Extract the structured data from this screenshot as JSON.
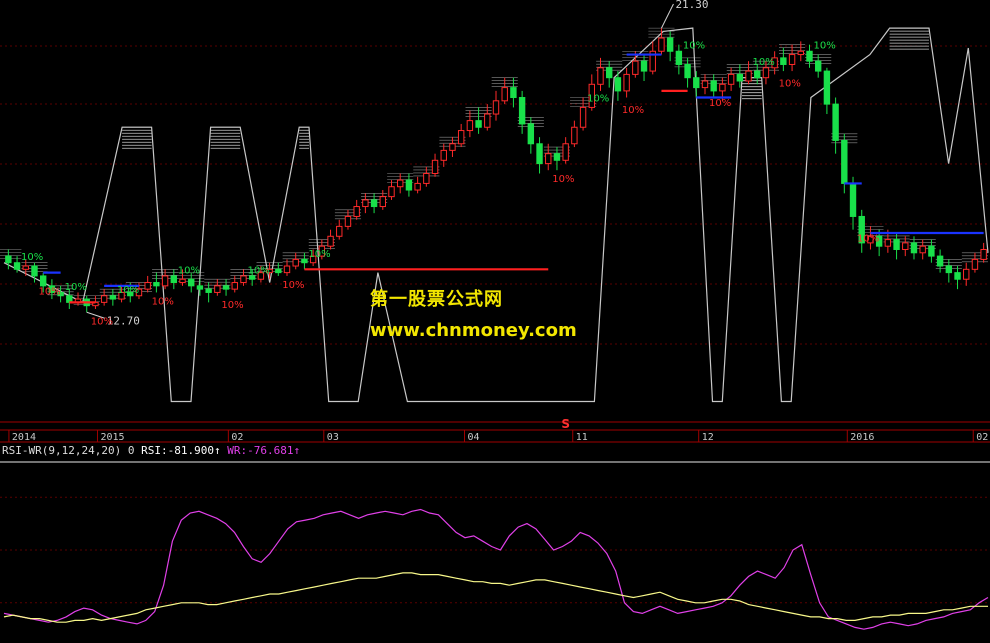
{
  "chart_data": {
    "type": "candlestick",
    "price_axis": {
      "min": 9.5,
      "max": 22.0
    },
    "price_high_label": "21.30",
    "price_low_label": "12.70",
    "signal_label": "10%",
    "pct_label_style": "±10%",
    "s_marker": "S",
    "time_axis_labels": [
      "2014",
      "2015",
      "02",
      "03",
      "04",
      "11",
      "12",
      "2016",
      "02"
    ],
    "candles": [
      [
        14.4,
        14.2,
        14.6,
        14.0
      ],
      [
        14.2,
        14.0,
        14.4,
        13.9
      ],
      [
        14.0,
        14.1,
        14.3,
        13.8
      ],
      [
        14.1,
        13.8,
        14.2,
        13.6
      ],
      [
        13.8,
        13.5,
        13.9,
        13.3
      ],
      [
        13.5,
        13.3,
        13.7,
        13.1
      ],
      [
        13.3,
        13.2,
        13.5,
        13.0
      ],
      [
        13.2,
        13.0,
        13.4,
        12.8
      ],
      [
        13.0,
        13.1,
        13.3,
        12.9
      ],
      [
        13.1,
        12.9,
        13.2,
        12.7
      ],
      [
        12.9,
        13.0,
        13.2,
        12.8
      ],
      [
        13.0,
        13.2,
        13.4,
        12.9
      ],
      [
        13.2,
        13.1,
        13.4,
        12.9
      ],
      [
        13.1,
        13.3,
        13.5,
        13.0
      ],
      [
        13.3,
        13.2,
        13.6,
        13.0
      ],
      [
        13.2,
        13.4,
        13.6,
        13.1
      ],
      [
        13.4,
        13.6,
        13.8,
        13.3
      ],
      [
        13.6,
        13.5,
        13.9,
        13.3
      ],
      [
        13.5,
        13.8,
        14.0,
        13.4
      ],
      [
        13.8,
        13.6,
        14.0,
        13.4
      ],
      [
        13.6,
        13.7,
        14.0,
        13.5
      ],
      [
        13.7,
        13.5,
        13.9,
        13.3
      ],
      [
        13.5,
        13.4,
        13.7,
        13.2
      ],
      [
        13.4,
        13.3,
        13.6,
        13.0
      ],
      [
        13.3,
        13.5,
        13.7,
        13.2
      ],
      [
        13.5,
        13.4,
        13.7,
        13.2
      ],
      [
        13.4,
        13.6,
        13.8,
        13.3
      ],
      [
        13.6,
        13.8,
        14.0,
        13.5
      ],
      [
        13.8,
        13.7,
        14.0,
        13.5
      ],
      [
        13.7,
        13.9,
        14.1,
        13.6
      ],
      [
        13.9,
        14.0,
        14.2,
        13.7
      ],
      [
        14.0,
        13.9,
        14.2,
        13.8
      ],
      [
        13.9,
        14.1,
        14.3,
        13.8
      ],
      [
        14.1,
        14.3,
        14.5,
        14.0
      ],
      [
        14.3,
        14.2,
        14.5,
        14.0
      ],
      [
        14.2,
        14.4,
        14.6,
        14.1
      ],
      [
        14.4,
        14.7,
        14.9,
        14.3
      ],
      [
        14.7,
        15.0,
        15.2,
        14.6
      ],
      [
        15.0,
        15.3,
        15.5,
        14.9
      ],
      [
        15.3,
        15.6,
        15.8,
        15.2
      ],
      [
        15.6,
        15.9,
        16.1,
        15.5
      ],
      [
        15.9,
        16.1,
        16.3,
        15.7
      ],
      [
        16.1,
        15.9,
        16.3,
        15.7
      ],
      [
        15.9,
        16.2,
        16.4,
        15.8
      ],
      [
        16.2,
        16.5,
        16.7,
        16.1
      ],
      [
        16.5,
        16.7,
        16.9,
        16.3
      ],
      [
        16.7,
        16.4,
        16.9,
        16.2
      ],
      [
        16.4,
        16.6,
        16.8,
        16.3
      ],
      [
        16.6,
        16.9,
        17.1,
        16.5
      ],
      [
        16.9,
        17.3,
        17.5,
        16.8
      ],
      [
        17.3,
        17.6,
        17.8,
        17.1
      ],
      [
        17.6,
        17.8,
        18.0,
        17.4
      ],
      [
        17.8,
        18.2,
        18.4,
        17.7
      ],
      [
        18.2,
        18.5,
        18.8,
        18.0
      ],
      [
        18.5,
        18.3,
        18.9,
        18.1
      ],
      [
        18.3,
        18.7,
        19.0,
        18.2
      ],
      [
        18.7,
        19.1,
        19.4,
        18.5
      ],
      [
        19.1,
        19.5,
        19.8,
        19.0
      ],
      [
        19.5,
        19.2,
        19.8,
        18.9
      ],
      [
        19.2,
        18.4,
        19.4,
        18.1
      ],
      [
        18.4,
        17.8,
        18.6,
        17.5
      ],
      [
        17.8,
        17.2,
        18.0,
        16.9
      ],
      [
        17.2,
        17.5,
        17.8,
        17.0
      ],
      [
        17.5,
        17.3,
        17.7,
        17.0
      ],
      [
        17.3,
        17.8,
        18.0,
        17.2
      ],
      [
        17.8,
        18.3,
        18.5,
        17.7
      ],
      [
        18.3,
        18.9,
        19.2,
        18.2
      ],
      [
        18.9,
        19.6,
        19.9,
        18.8
      ],
      [
        19.6,
        20.1,
        20.4,
        19.4
      ],
      [
        20.1,
        19.8,
        20.3,
        19.5
      ],
      [
        19.8,
        19.4,
        20.0,
        19.1
      ],
      [
        19.4,
        19.9,
        20.1,
        19.2
      ],
      [
        19.9,
        20.3,
        20.6,
        19.8
      ],
      [
        20.3,
        20.0,
        20.5,
        19.7
      ],
      [
        20.0,
        20.6,
        20.9,
        19.9
      ],
      [
        20.6,
        21.0,
        21.3,
        20.5
      ],
      [
        21.0,
        20.6,
        21.2,
        20.3
      ],
      [
        20.6,
        20.2,
        20.8,
        19.9
      ],
      [
        20.2,
        19.8,
        20.4,
        19.5
      ],
      [
        19.8,
        19.5,
        20.0,
        19.2
      ],
      [
        19.5,
        19.7,
        19.9,
        19.3
      ],
      [
        19.7,
        19.4,
        19.9,
        19.2
      ],
      [
        19.4,
        19.6,
        19.8,
        19.1
      ],
      [
        19.6,
        19.9,
        20.1,
        19.4
      ],
      [
        19.9,
        19.7,
        20.2,
        19.5
      ],
      [
        19.7,
        20.0,
        20.3,
        19.6
      ],
      [
        20.0,
        19.8,
        20.2,
        19.6
      ],
      [
        19.8,
        20.1,
        20.3,
        19.6
      ],
      [
        20.1,
        20.4,
        20.6,
        19.9
      ],
      [
        20.4,
        20.2,
        20.7,
        20.0
      ],
      [
        20.2,
        20.5,
        20.8,
        20.0
      ],
      [
        20.5,
        20.6,
        20.9,
        20.3
      ],
      [
        20.6,
        20.3,
        20.8,
        20.1
      ],
      [
        20.3,
        20.0,
        20.5,
        19.8
      ],
      [
        20.0,
        19.0,
        20.1,
        18.7
      ],
      [
        19.0,
        17.9,
        19.2,
        17.5
      ],
      [
        17.9,
        16.6,
        18.1,
        16.3
      ],
      [
        16.6,
        15.6,
        16.8,
        15.2
      ],
      [
        15.6,
        14.8,
        15.8,
        14.5
      ],
      [
        14.8,
        15.0,
        15.3,
        14.6
      ],
      [
        15.0,
        14.7,
        15.2,
        14.4
      ],
      [
        14.7,
        14.9,
        15.2,
        14.5
      ],
      [
        14.9,
        14.6,
        15.1,
        14.3
      ],
      [
        14.6,
        14.8,
        15.0,
        14.4
      ],
      [
        14.8,
        14.5,
        15.0,
        14.3
      ],
      [
        14.5,
        14.7,
        14.9,
        14.3
      ],
      [
        14.7,
        14.4,
        14.9,
        14.2
      ],
      [
        14.4,
        14.1,
        14.6,
        13.9
      ],
      [
        14.1,
        13.9,
        14.3,
        13.6
      ],
      [
        13.9,
        13.7,
        14.1,
        13.4
      ],
      [
        13.7,
        14.0,
        14.2,
        13.5
      ],
      [
        14.0,
        14.3,
        14.5,
        13.9
      ],
      [
        14.3,
        14.6,
        14.8,
        14.2
      ]
    ],
    "stop_line_segments": [
      {
        "from": 4,
        "to": 6,
        "value": 13.9,
        "color": "#1a33ff"
      },
      {
        "from": 7,
        "to": 10,
        "value": 13.0,
        "color": "#ff2020"
      },
      {
        "from": 11,
        "to": 15,
        "value": 13.5,
        "color": "#1a33ff"
      },
      {
        "from": 34,
        "to": 62,
        "value": 14.0,
        "color": "#ff2020"
      },
      {
        "from": 71,
        "to": 75,
        "value": 20.5,
        "color": "#1a33ff"
      },
      {
        "from": 75,
        "to": 78,
        "value": 19.4,
        "color": "#ff2020"
      },
      {
        "from": 79,
        "to": 83,
        "value": 19.2,
        "color": "#1a33ff"
      },
      {
        "from": 96,
        "to": 98,
        "value": 16.6,
        "color": "#1a33ff"
      },
      {
        "from": 99,
        "to": 112,
        "value": 15.1,
        "color": "#1a33ff"
      }
    ],
    "zigzag": [
      [
        0,
        14.2
      ],
      [
        8,
        13.0
      ],
      [
        12,
        18.3
      ],
      [
        15,
        18.3
      ],
      [
        17,
        10.0
      ],
      [
        19,
        10.0
      ],
      [
        21,
        18.3
      ],
      [
        24,
        18.3
      ],
      [
        27,
        13.6
      ],
      [
        30,
        18.3
      ],
      [
        31,
        18.3
      ],
      [
        33,
        10.0
      ],
      [
        36,
        10.0
      ],
      [
        38,
        13.9
      ],
      [
        41,
        10.0
      ],
      [
        60,
        10.0
      ],
      [
        62,
        19.8
      ],
      [
        67,
        21.2
      ],
      [
        70,
        21.3
      ],
      [
        72,
        10.0
      ],
      [
        73,
        10.0
      ],
      [
        75,
        19.8
      ],
      [
        77,
        19.8
      ],
      [
        79,
        10.0
      ],
      [
        80,
        10.0
      ],
      [
        82,
        19.2
      ],
      [
        88,
        20.5
      ],
      [
        90,
        21.3
      ],
      [
        94,
        21.3
      ],
      [
        96,
        17.2
      ],
      [
        98,
        20.7
      ],
      [
        100,
        14.5
      ]
    ],
    "indicator": {
      "title": "RSI-WR(9,12,24,20)",
      "param": "0",
      "rsi_label": "RSI:",
      "rsi_value": "-81.900",
      "wr_label": "WR:",
      "wr_value": "-76.681",
      "arrow": "↑",
      "rsi_series": [
        -88,
        -87,
        -88,
        -89,
        -89,
        -90,
        -91,
        -91,
        -90,
        -90,
        -89,
        -90,
        -89,
        -88,
        -87,
        -86,
        -84,
        -83,
        -82,
        -81,
        -80,
        -80,
        -80,
        -81,
        -81,
        -80,
        -79,
        -78,
        -77,
        -76,
        -75,
        -75,
        -74,
        -73,
        -72,
        -71,
        -70,
        -69,
        -68,
        -67,
        -66,
        -66,
        -66,
        -65,
        -64,
        -63,
        -63,
        -64,
        -64,
        -64,
        -65,
        -66,
        -67,
        -68,
        -68,
        -69,
        -69,
        -70,
        -69,
        -68,
        -67,
        -67,
        -68,
        -69,
        -70,
        -71,
        -72,
        -73,
        -74,
        -75,
        -76,
        -77,
        -76,
        -75,
        -74,
        -76,
        -78,
        -79,
        -80,
        -80,
        -79,
        -78,
        -78,
        -79,
        -81,
        -82,
        -83,
        -84,
        -85,
        -86,
        -87,
        -88,
        -88,
        -89,
        -89,
        -90,
        -90,
        -89,
        -88,
        -88,
        -87,
        -87,
        -86,
        -86,
        -86,
        -85,
        -84,
        -84,
        -83,
        -82,
        -82,
        -82
      ],
      "wr_series": [
        -86,
        -87,
        -88,
        -89,
        -90,
        -91,
        -90,
        -88,
        -85,
        -83,
        -84,
        -87,
        -89,
        -90,
        -91,
        -92,
        -90,
        -85,
        -70,
        -45,
        -33,
        -29,
        -28,
        -30,
        -32,
        -35,
        -40,
        -48,
        -55,
        -57,
        -52,
        -45,
        -38,
        -34,
        -33,
        -32,
        -30,
        -29,
        -28,
        -30,
        -32,
        -30,
        -29,
        -28,
        -29,
        -30,
        -28,
        -27,
        -29,
        -30,
        -35,
        -40,
        -43,
        -42,
        -45,
        -48,
        -50,
        -42,
        -37,
        -35,
        -38,
        -44,
        -50,
        -48,
        -45,
        -40,
        -42,
        -46,
        -52,
        -62,
        -80,
        -85,
        -86,
        -84,
        -82,
        -84,
        -86,
        -85,
        -84,
        -83,
        -82,
        -80,
        -76,
        -70,
        -65,
        -62,
        -64,
        -66,
        -60,
        -50,
        -47,
        -64,
        -80,
        -88,
        -90,
        -92,
        -94,
        -95,
        -94,
        -92,
        -91,
        -92,
        -93,
        -92,
        -90,
        -89,
        -88,
        -86,
        -85,
        -84,
        -80,
        -77
      ]
    },
    "colors": {
      "up": "#ff2a2a",
      "down": "#19e04a",
      "stair": "#c8c8c8",
      "axis": "#a00000",
      "rsi": "#f8f88a",
      "wr": "#e040e8",
      "watermark": "#f2e600"
    }
  },
  "watermark": {
    "line1": "第一股票公式网",
    "line2": "www.chnmoney.com"
  }
}
